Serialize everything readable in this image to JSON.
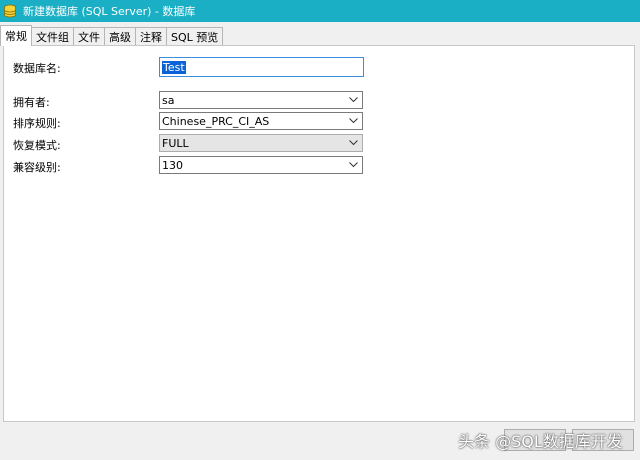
{
  "window": {
    "title": "新建数据库 (SQL Server) - 数据库"
  },
  "tabs": [
    {
      "label": "常规",
      "active": true
    },
    {
      "label": "文件组"
    },
    {
      "label": "文件"
    },
    {
      "label": "高级"
    },
    {
      "label": "注释"
    },
    {
      "label": "SQL 预览"
    }
  ],
  "form": {
    "db_name": {
      "label": "数据库名:",
      "value": "Test"
    },
    "owner": {
      "label": "拥有者:",
      "value": "sa"
    },
    "collation": {
      "label": "排序规则:",
      "value": "Chinese_PRC_CI_AS"
    },
    "recovery": {
      "label": "恢复模式:",
      "value": "FULL"
    },
    "compat": {
      "label": "兼容级别:",
      "value": "130"
    }
  },
  "watermark": "头条 @SQL数据库开发",
  "icons": {
    "app": "database-icon",
    "dropdown": "chevron-down-icon"
  },
  "colors": {
    "titlebar": "#1aafc4",
    "selection": "#0a64d8"
  }
}
